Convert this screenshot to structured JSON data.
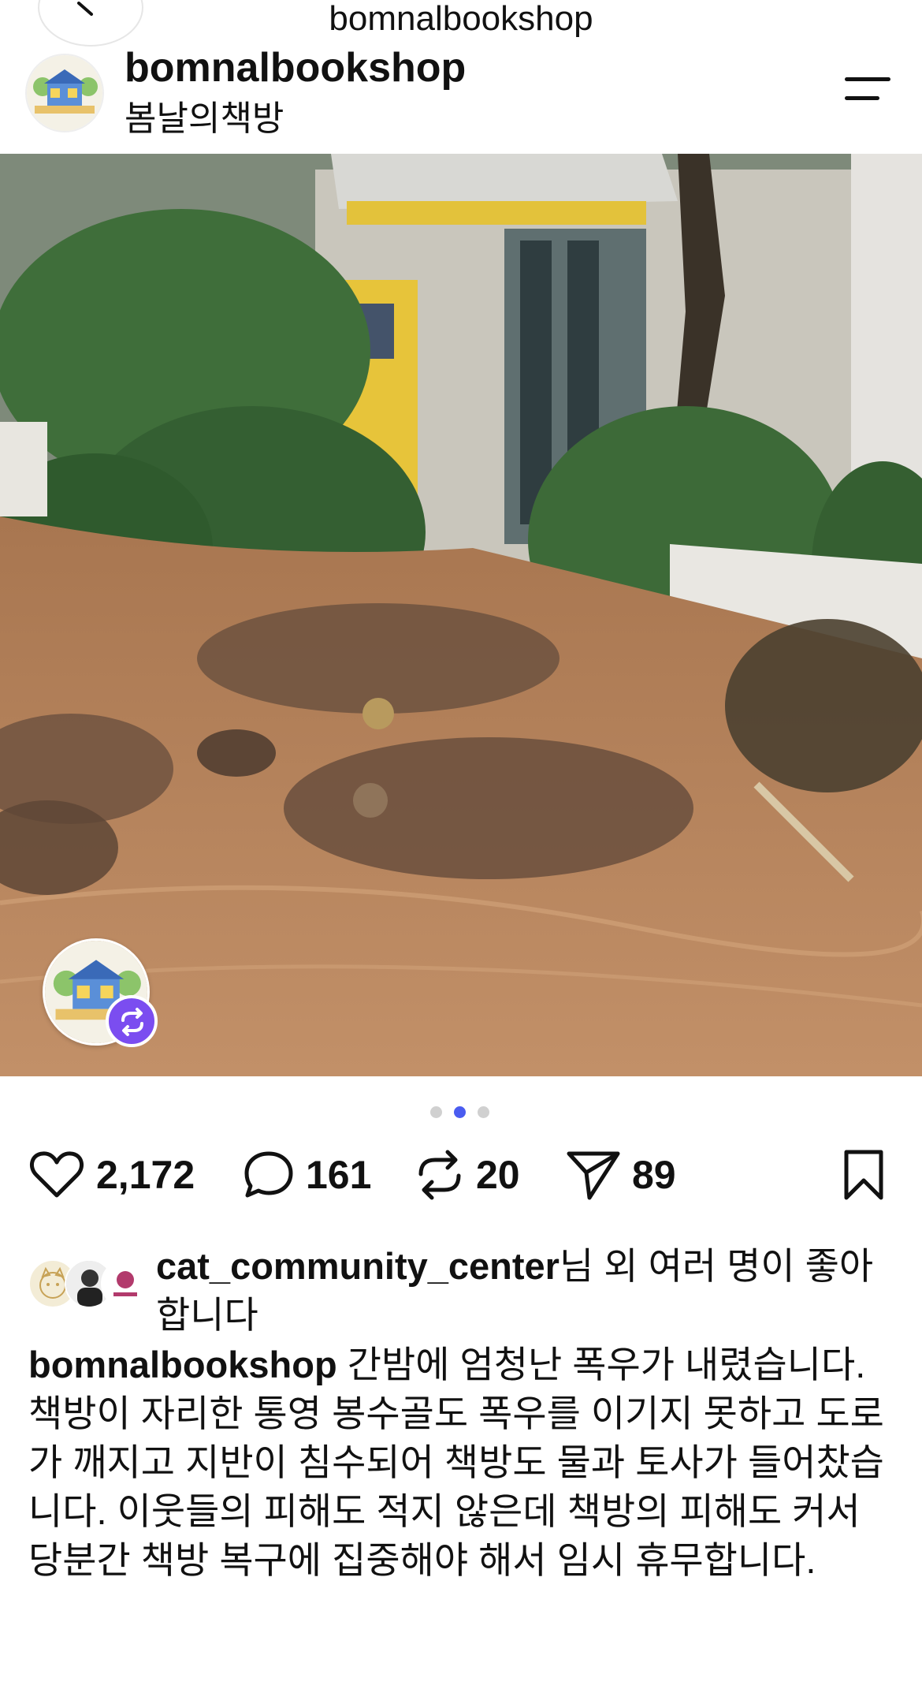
{
  "header": {
    "page_title": "bomnalbookshop",
    "handle": "bomnalbookshop",
    "display_name": "봄날의책방"
  },
  "icons": {
    "back": "chevron-left-icon",
    "menu": "hamburger-menu-icon",
    "like": "heart-icon",
    "comment": "comment-bubble-icon",
    "repost": "repost-icon",
    "share": "send-icon",
    "save": "bookmark-icon"
  },
  "carousel": {
    "total": 3,
    "active_index": 1
  },
  "actions": {
    "likes": "2,172",
    "comments": "161",
    "reposts": "20",
    "shares": "89"
  },
  "liked_by": {
    "user": "cat_community_center",
    "rest": "님 외 여러 명이 좋아합니다"
  },
  "caption": {
    "user": "bomnalbookshop",
    "text": " 간밤에 엄청난 폭우가 내렸습니다. 책방이 자리한 통영 봉수골도 폭우를 이기지 못하고 도로가 깨지고 지반이 침수되어 책방도 물과 토사가 들어찼습니다. 이웃들의 피해도 적지 않은데 책방의 피해도 커서 당분간 책방 복구에 집중해야 해서 임시 휴무합니다."
  },
  "colors": {
    "accent": "#4a5cf0",
    "repost_badge": "#7b4df0",
    "mud": "#b8835a"
  }
}
